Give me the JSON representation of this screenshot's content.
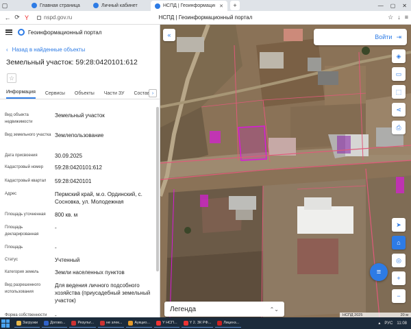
{
  "browser": {
    "tabs": [
      {
        "label": "Главная страница",
        "active": false
      },
      {
        "label": "Личный кабинет",
        "active": false
      },
      {
        "label": "НСПД | Геоинформационный портал",
        "active": true
      }
    ],
    "url": "nspd.gov.ru",
    "page_title": "НСПД | Геоинформационный портал"
  },
  "portal": {
    "name": "Геоинформационный портал",
    "back_label": "Назад в найденные объекты",
    "title": "Земельный участок: 59:28:0420101:612",
    "tabs": [
      "Информация",
      "Сервисы",
      "Объекты",
      "Части ЗУ",
      "Состав"
    ],
    "active_tab": "Информация",
    "properties": [
      {
        "key": "Вид объекта недвижимости",
        "value": "Земельный участок"
      },
      {
        "key": "Вид земельного участка",
        "value": "Землепользование"
      },
      {
        "key": "Дата присвоения",
        "value": "30.09.2025"
      },
      {
        "key": "Кадастровый номер",
        "value": "59:28:0420101:612"
      },
      {
        "key": "Кадастровый квартал",
        "value": "59:28:0420101"
      },
      {
        "key": "Адрес",
        "value": "Пермский край, м.о. Ординский, с. Сосновка, ул. Молодежная"
      },
      {
        "key": "Площадь уточненная",
        "value": "800 кв. м"
      },
      {
        "key": "Площадь декларированная",
        "value": "-"
      },
      {
        "key": "Площадь",
        "value": "-"
      },
      {
        "key": "Статус",
        "value": "Учтенный"
      },
      {
        "key": "Категория земель",
        "value": "Земли населенных пунктов"
      },
      {
        "key": "Вид разрешенного использования",
        "value": "Для ведения личного подсобного хозяйства (приусадебный земельный участок)"
      },
      {
        "key": "Форма собственности",
        "value": "-"
      }
    ]
  },
  "map": {
    "login_label": "Войти",
    "legend_label": "Легенда",
    "copyright": "НСПД 2025",
    "scale": "20 м",
    "tools": [
      "layers-icon",
      "ruler-icon",
      "select-icon",
      "share-icon",
      "print-icon"
    ],
    "tools_bottom": [
      "locate-icon",
      "home-icon",
      "gps-icon",
      "zoom-in-icon",
      "zoom-out-icon"
    ]
  },
  "taskbar": {
    "items": [
      "Загрузки",
      "Догово...",
      "Результ...",
      "не злек...",
      "Аукцио...",
      "Y НСП...",
      "Y 2. ЗК РФ...",
      "Лиценз..."
    ],
    "lang": "РУС",
    "time": "11:08"
  },
  "colors": {
    "accent": "#2d7be5",
    "parcel": "#d81bd8",
    "boundary": "#e05a7a"
  }
}
